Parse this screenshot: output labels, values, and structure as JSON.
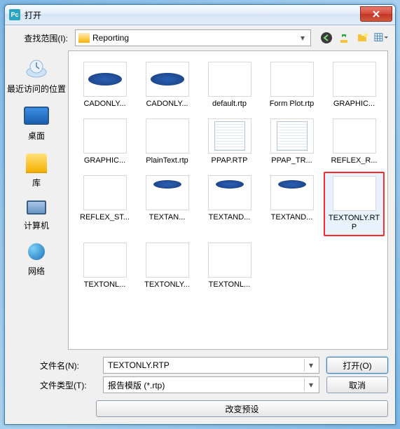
{
  "title_icon": "Pc",
  "window_title": "打开",
  "toolbar": {
    "lookin_label": "查找范围(I):",
    "folder_name": "Reporting",
    "nav": {
      "back": "back-icon",
      "up": "up-icon",
      "newfolder": "newfolder-icon",
      "views": "views-icon"
    }
  },
  "sidebar": {
    "items": [
      {
        "icon": "recent-icon",
        "label": "最近访问的位置"
      },
      {
        "icon": "desktop-icon",
        "label": "桌面"
      },
      {
        "icon": "library-icon",
        "label": "库"
      },
      {
        "icon": "computer-icon",
        "label": "计算机"
      },
      {
        "icon": "network-icon",
        "label": "网络"
      }
    ]
  },
  "files": [
    {
      "label": "CADONLY...",
      "thumb": "cad",
      "selected": false
    },
    {
      "label": "CADONLY...",
      "thumb": "cad",
      "selected": false
    },
    {
      "label": "default.rtp",
      "thumb": "blank",
      "selected": false
    },
    {
      "label": "Form Plot.rtp",
      "thumb": "blank",
      "selected": false
    },
    {
      "label": "GRAPHIC...",
      "thumb": "blank",
      "selected": false
    },
    {
      "label": "GRAPHIC...",
      "thumb": "blank",
      "selected": false
    },
    {
      "label": "PlainText.rtp",
      "thumb": "blank",
      "selected": false
    },
    {
      "label": "PPAP.RTP",
      "thumb": "tbl",
      "selected": false
    },
    {
      "label": "PPAP_TR...",
      "thumb": "tbl",
      "selected": false
    },
    {
      "label": "REFLEX_R...",
      "thumb": "blank",
      "selected": false
    },
    {
      "label": "REFLEX_ST...",
      "thumb": "blank",
      "selected": false
    },
    {
      "label": "TEXTAN...",
      "thumb": "mix",
      "selected": false
    },
    {
      "label": "TEXTAND...",
      "thumb": "mix",
      "selected": false
    },
    {
      "label": "TEXTAND...",
      "thumb": "mix",
      "selected": false
    },
    {
      "label": "TEXTONLY.RTP",
      "thumb": "blank",
      "selected": true
    },
    {
      "label": "TEXTONL...",
      "thumb": "blank",
      "selected": false
    },
    {
      "label": "TEXTONLY...",
      "thumb": "blank",
      "selected": false
    },
    {
      "label": "TEXTONL...",
      "thumb": "blank",
      "selected": false
    }
  ],
  "footer": {
    "filename_label": "文件名(N):",
    "filename_value": "TEXTONLY.RTP",
    "filetype_label": "文件类型(T):",
    "filetype_value": "报告模版 (*.rtp)",
    "open_label": "打开(O)",
    "cancel_label": "取消",
    "change_preview_label": "改变预设"
  }
}
